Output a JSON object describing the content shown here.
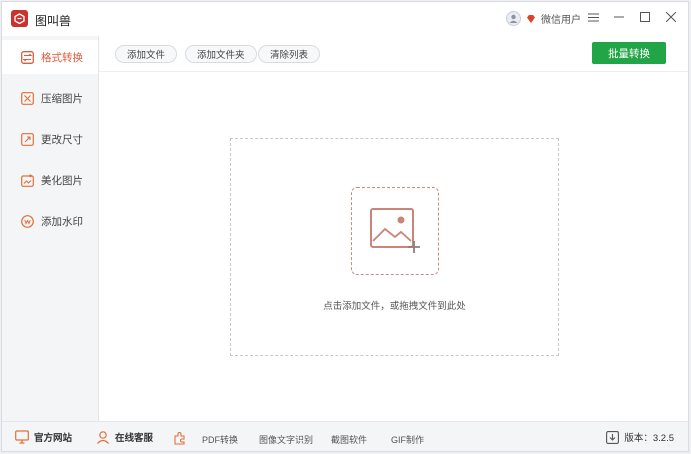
{
  "app": {
    "title": "图叫兽"
  },
  "user": {
    "name": "微信用户"
  },
  "sidebar": {
    "items": [
      {
        "label": "格式转换",
        "icon": "format-convert-icon",
        "active": true
      },
      {
        "label": "压缩图片",
        "icon": "compress-icon",
        "active": false
      },
      {
        "label": "更改尺寸",
        "icon": "resize-icon",
        "active": false
      },
      {
        "label": "美化图片",
        "icon": "beautify-icon",
        "active": false
      },
      {
        "label": "添加水印",
        "icon": "watermark-icon",
        "active": false
      }
    ]
  },
  "toolbar": {
    "add_file": "添加文件",
    "add_folder": "添加文件夹",
    "clear_list": "清除列表",
    "batch_convert": "批量转换"
  },
  "dropzone": {
    "hint": "点击添加文件，或拖拽文件到此处"
  },
  "footer": {
    "website": "官方网站",
    "support": "在线客服",
    "pdf": "PDF转换",
    "ocr": "图像文字识别",
    "screenshot": "截图软件",
    "gif": "GIF制作",
    "version": "版本：3.2.5"
  },
  "colors": {
    "accent": "#e05a3a",
    "brand": "#c9322e",
    "primary_button": "#21a546"
  }
}
